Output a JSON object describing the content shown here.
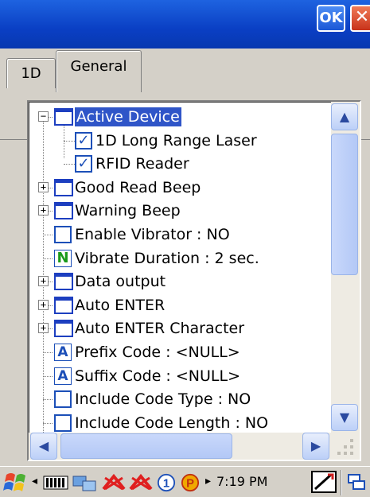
{
  "window": {
    "ok_label": "OK",
    "close_label": "✕"
  },
  "tabs": [
    {
      "label": "1D"
    },
    {
      "label": "General"
    }
  ],
  "tree": {
    "items": [
      {
        "label": "Active Device",
        "expander": "−",
        "icon": "folder",
        "selected": true
      },
      {
        "label": "1D Long Range Laser",
        "icon": "checkbox",
        "checked": true
      },
      {
        "label": "RFID Reader",
        "icon": "checkbox",
        "checked": true
      },
      {
        "label": "Good Read Beep",
        "expander": "+",
        "icon": "folder"
      },
      {
        "label": "Warning Beep",
        "expander": "+",
        "icon": "folder"
      },
      {
        "label": "Enable Vibrator :  NO",
        "icon": "checkbox",
        "checked": false
      },
      {
        "label": "Vibrate Duration :  2  sec.",
        "icon": "numeric",
        "badge": "N"
      },
      {
        "label": "Data output",
        "expander": "+",
        "icon": "folder"
      },
      {
        "label": "Auto ENTER",
        "expander": "+",
        "icon": "folder"
      },
      {
        "label": "Auto ENTER Character",
        "expander": "+",
        "icon": "folder"
      },
      {
        "label": "Prefix Code :  <NULL>",
        "icon": "text",
        "badge": "A"
      },
      {
        "label": "Suffix Code :  <NULL>",
        "icon": "text",
        "badge": "A"
      },
      {
        "label": "Include Code Type :  NO",
        "icon": "checkbox",
        "checked": false
      },
      {
        "label": "Include Code Length :  NO",
        "icon": "checkbox",
        "checked": false
      }
    ]
  },
  "scrollbars": {
    "up_arrow": "▲",
    "down_arrow": "▼",
    "left_arrow": "◀",
    "right_arrow": "▶"
  },
  "taskbar": {
    "time": "7:19 PM",
    "left_arrow": "◂",
    "right_arrow": "▸",
    "icons": [
      "start-flag-icon",
      "battery-icon",
      "network-icon",
      "no-signal-icon",
      "no-signal-icon-2",
      "number-one-icon",
      "parking-icon",
      "keyboard-icon",
      "window-switch-icon"
    ]
  },
  "colors": {
    "titlebar": "#0a3fc4",
    "selection": "#2f55c8",
    "accent_blue": "#1c4fb8",
    "numeric_green": "#1a9a1a"
  }
}
